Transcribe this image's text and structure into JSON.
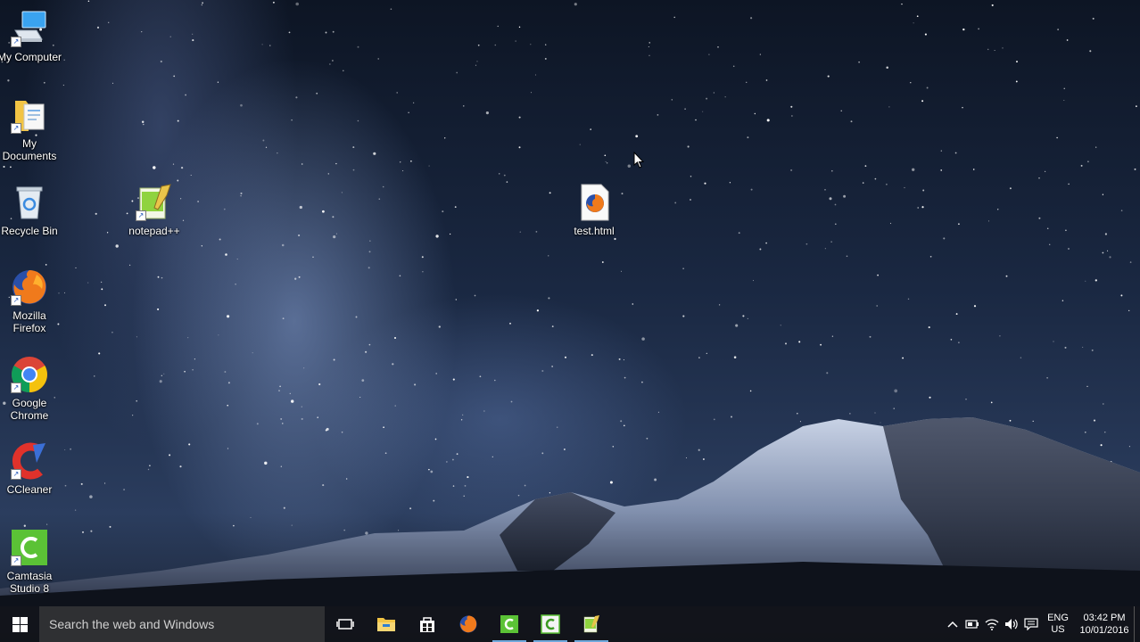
{
  "desktop_icons": {
    "my_computer": "My Computer",
    "my_documents": "My Documents",
    "recycle_bin": "Recycle Bin",
    "mozilla_firefox": "Mozilla Firefox",
    "google_chrome": "Google Chrome",
    "ccleaner": "CCleaner",
    "camtasia": "Camtasia Studio 8",
    "notepadpp": "notepad++",
    "test_html": "test.html"
  },
  "taskbar": {
    "search_placeholder": "Search the web and Windows",
    "pinned_icons": [
      "task-view-icon",
      "file-explorer-icon",
      "store-icon",
      "firefox-icon",
      "camtasia-icon",
      "camtasia-recorder-icon",
      "notepadpp-icon"
    ],
    "tray": {
      "lang_top": "ENG",
      "lang_bottom": "US",
      "time": "03:42 PM",
      "date": "10/01/2016"
    }
  },
  "colors": {
    "taskbar": "#12141a",
    "search_box": "#2f3033",
    "running_indicator": "#6fa8dc"
  }
}
